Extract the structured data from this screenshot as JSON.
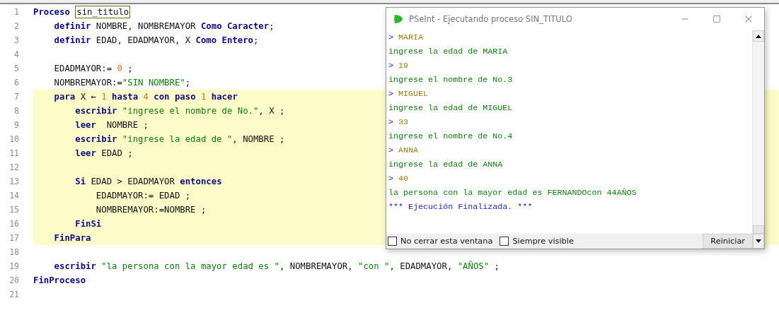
{
  "editor": {
    "lines": [
      {
        "number": "1",
        "highlighted": false,
        "tokens": [
          {
            "kind": "kw",
            "text": "Proceso "
          },
          {
            "kind": "marked",
            "text": "sin_titulo"
          }
        ]
      },
      {
        "number": "2",
        "highlighted": false,
        "tokens": [
          {
            "kind": "kw",
            "text": "    definir"
          },
          {
            "kind": "id",
            "text": " NOMBRE, NOMBREMAYOR "
          },
          {
            "kind": "kw",
            "text": "Como Caracter"
          },
          {
            "kind": "id",
            "text": ";"
          }
        ]
      },
      {
        "number": "3",
        "highlighted": false,
        "tokens": [
          {
            "kind": "kw",
            "text": "    definir"
          },
          {
            "kind": "id",
            "text": " EDAD, EDADMAYOR, X "
          },
          {
            "kind": "kw",
            "text": "Como Entero"
          },
          {
            "kind": "id",
            "text": ";"
          }
        ]
      },
      {
        "number": "4",
        "highlighted": false
      },
      {
        "number": "5",
        "highlighted": false,
        "tokens": [
          {
            "kind": "id",
            "text": "    EDADMAYOR:= "
          },
          {
            "kind": "num",
            "text": "0"
          },
          {
            "kind": "id",
            "text": " ;"
          }
        ]
      },
      {
        "number": "6",
        "highlighted": false,
        "tokens": [
          {
            "kind": "id",
            "text": "    NOMBREMAYOR:="
          },
          {
            "kind": "str",
            "text": "\"SIN NOMBRE\""
          },
          {
            "kind": "id",
            "text": ";"
          }
        ]
      },
      {
        "number": "7",
        "highlighted": true,
        "tokens": [
          {
            "kind": "kw",
            "text": "    para"
          },
          {
            "kind": "id",
            "text": " X ← "
          },
          {
            "kind": "num",
            "text": "1"
          },
          {
            "kind": "kw",
            "text": " hasta "
          },
          {
            "kind": "num",
            "text": "4"
          },
          {
            "kind": "kw",
            "text": " con paso "
          },
          {
            "kind": "num",
            "text": "1"
          },
          {
            "kind": "kw",
            "text": " hacer"
          }
        ]
      },
      {
        "number": "8",
        "highlighted": true,
        "tokens": [
          {
            "kind": "kw",
            "text": "        escribir "
          },
          {
            "kind": "str",
            "text": "\"ingrese el nombre de No.\""
          },
          {
            "kind": "id",
            "text": ", X ;"
          }
        ]
      },
      {
        "number": "9",
        "highlighted": true,
        "tokens": [
          {
            "kind": "kw",
            "text": "        leer"
          },
          {
            "kind": "id",
            "text": "  NOMBRE ;"
          }
        ]
      },
      {
        "number": "10",
        "highlighted": true,
        "tokens": [
          {
            "kind": "kw",
            "text": "        escribir "
          },
          {
            "kind": "str",
            "text": "\"ingrese la edad de \""
          },
          {
            "kind": "id",
            "text": ", NOMBRE ;"
          }
        ]
      },
      {
        "number": "11",
        "highlighted": true,
        "tokens": [
          {
            "kind": "kw",
            "text": "        leer"
          },
          {
            "kind": "id",
            "text": " EDAD ;"
          }
        ]
      },
      {
        "number": "12",
        "highlighted": true
      },
      {
        "number": "13",
        "highlighted": true,
        "tokens": [
          {
            "kind": "kw",
            "text": "        Si"
          },
          {
            "kind": "id",
            "text": " EDAD > EDADMAYOR "
          },
          {
            "kind": "kw",
            "text": "entonces"
          }
        ]
      },
      {
        "number": "14",
        "highlighted": true,
        "tokens": [
          {
            "kind": "id",
            "text": "            EDADMAYOR:= EDAD ;"
          }
        ]
      },
      {
        "number": "15",
        "highlighted": true,
        "tokens": [
          {
            "kind": "id",
            "text": "            NOMBREMAYOR:=NOMBRE ;"
          }
        ]
      },
      {
        "number": "16",
        "highlighted": true,
        "tokens": [
          {
            "kind": "kw",
            "text": "        FinSi"
          }
        ]
      },
      {
        "number": "17",
        "highlighted": true,
        "tokens": [
          {
            "kind": "kw",
            "text": "    FinPara"
          }
        ]
      },
      {
        "number": "18",
        "highlighted": false
      },
      {
        "number": "19",
        "highlighted": false,
        "tokens": [
          {
            "kind": "kw",
            "text": "    escribir "
          },
          {
            "kind": "str",
            "text": "\"la persona con la mayor edad es \""
          },
          {
            "kind": "id",
            "text": ", NOMBREMAYOR, "
          },
          {
            "kind": "str",
            "text": "\"con \""
          },
          {
            "kind": "id",
            "text": ", EDADMAYOR, "
          },
          {
            "kind": "str",
            "text": "\"AÑOS\""
          },
          {
            "kind": "id",
            "text": " ;"
          }
        ]
      },
      {
        "number": "20",
        "highlighted": false,
        "tokens": [
          {
            "kind": "kw",
            "text": "FinProceso"
          }
        ]
      },
      {
        "number": "21",
        "highlighted": false
      }
    ]
  },
  "console_window": {
    "title": "PSeInt - Ejecutando proceso SIN_TITULO",
    "lines": [
      {
        "kind": "input",
        "prompt": ">",
        "text": "MARIA"
      },
      {
        "kind": "output",
        "text": "ingrese la edad de MARIA"
      },
      {
        "kind": "input",
        "prompt": ">",
        "text": "19"
      },
      {
        "kind": "output",
        "text": "ingrese el nombre de No.3"
      },
      {
        "kind": "input",
        "prompt": ">",
        "text": "MIGUEL"
      },
      {
        "kind": "output",
        "text": "ingrese la edad de MIGUEL"
      },
      {
        "kind": "input",
        "prompt": ">",
        "text": "33"
      },
      {
        "kind": "output",
        "text": "ingrese el nombre de No.4"
      },
      {
        "kind": "input",
        "prompt": ">",
        "text": "ANNA"
      },
      {
        "kind": "output",
        "text": "ingrese la edad de ANNA"
      },
      {
        "kind": "input",
        "prompt": ">",
        "text": "40"
      },
      {
        "kind": "output",
        "text": "la persona con la mayor edad es FERNANDOcon 44AÑOS"
      },
      {
        "kind": "status",
        "text": "*** Ejecución Finalizada. ***"
      }
    ],
    "options": [
      {
        "label": "No cerrar esta ventana",
        "checked": false
      },
      {
        "label": "Siempre visible",
        "checked": false
      }
    ],
    "button": "Reiniciar"
  }
}
